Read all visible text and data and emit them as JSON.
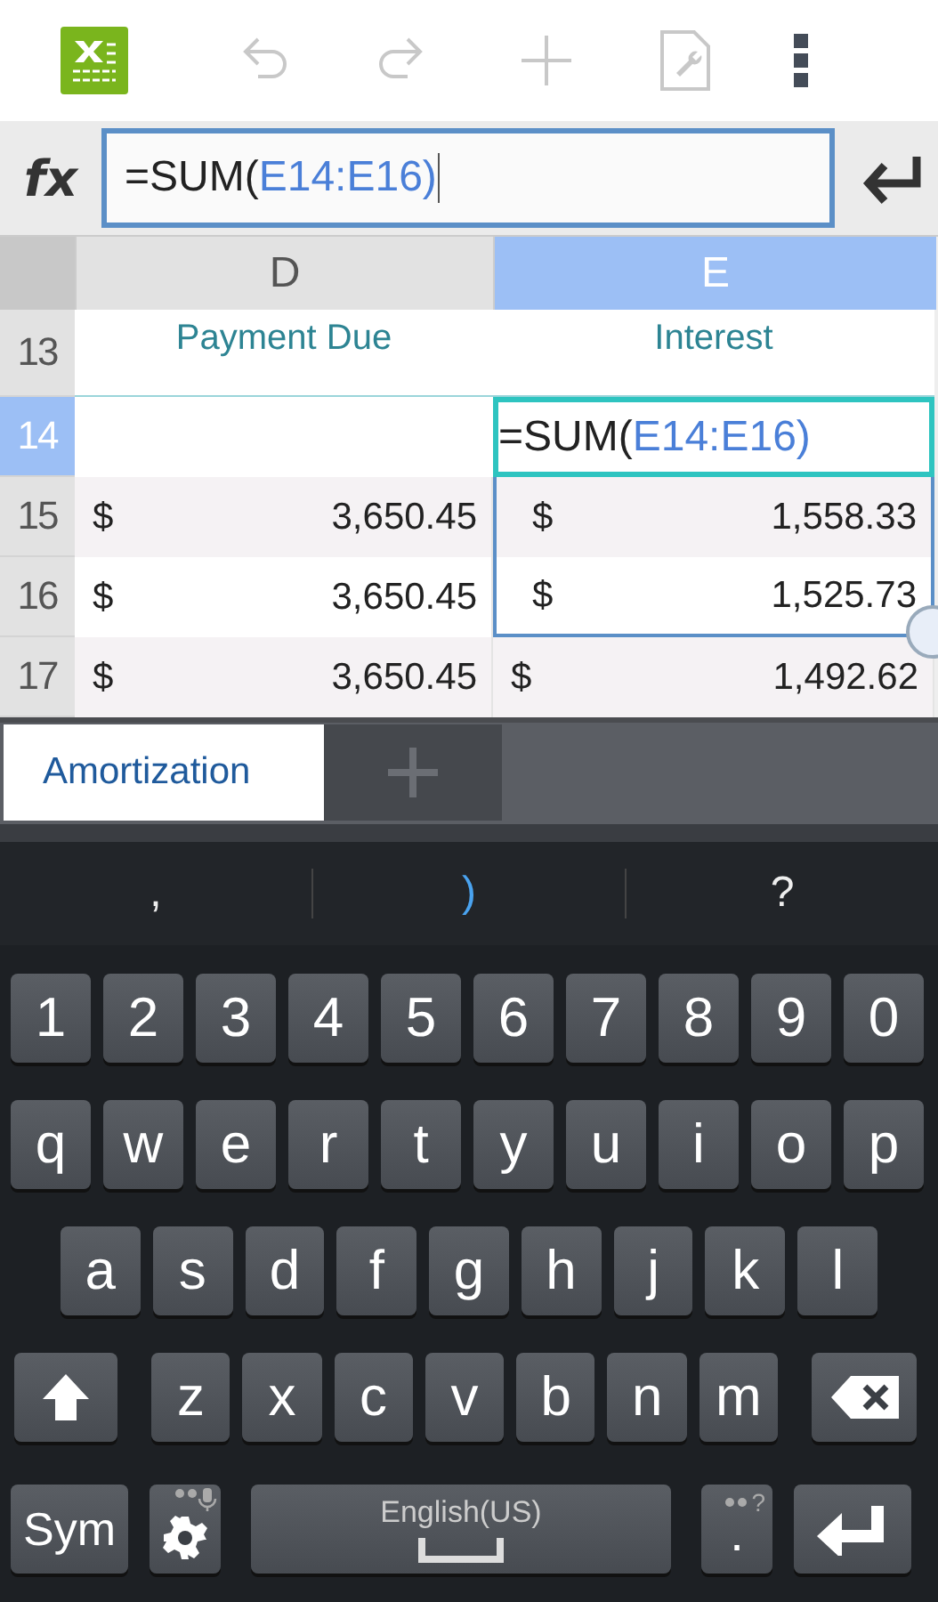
{
  "formula_bar": {
    "label": "fx",
    "parts": [
      {
        "text": "=SUM(",
        "kind": "plain"
      },
      {
        "text": "E14:E16)",
        "kind": "reference"
      }
    ]
  },
  "columns": [
    {
      "label": "D",
      "selected": false
    },
    {
      "label": "E",
      "selected": true
    }
  ],
  "rows": [
    {
      "number": "13",
      "selected": false,
      "kind": "heading",
      "cells": [
        {
          "kind": "heading",
          "text": "Payment Due"
        },
        {
          "kind": "heading",
          "text": "Interest"
        }
      ]
    },
    {
      "number": "14",
      "selected": true,
      "kind": "plain",
      "cells": [
        {
          "kind": "blank"
        },
        {
          "kind": "formula",
          "parts": [
            {
              "text": "=SUM(",
              "kind": "plain"
            },
            {
              "text": "E14:E16)",
              "kind": "reference"
            }
          ]
        }
      ]
    },
    {
      "number": "15",
      "selected": false,
      "kind": "shaded",
      "cells": [
        {
          "kind": "money",
          "currency": "$",
          "amount": "3,650.45",
          "in_range": false
        },
        {
          "kind": "money",
          "currency": "$",
          "amount": "1,558.33",
          "in_range": true
        }
      ]
    },
    {
      "number": "16",
      "selected": false,
      "kind": "plain",
      "cells": [
        {
          "kind": "money",
          "currency": "$",
          "amount": "3,650.45",
          "in_range": false
        },
        {
          "kind": "money",
          "currency": "$",
          "amount": "1,525.73",
          "in_range": true
        }
      ]
    },
    {
      "number": "17",
      "selected": false,
      "kind": "shaded",
      "cells": [
        {
          "kind": "money",
          "currency": "$",
          "amount": "3,650.45",
          "in_range": false
        },
        {
          "kind": "money",
          "currency": "$",
          "amount": "1,492.62",
          "in_range": false
        }
      ]
    }
  ],
  "sheet_tabs": [
    {
      "label": "Amortization",
      "selected": true
    }
  ],
  "suggestions": [
    {
      "text": ",",
      "selected": false
    },
    {
      "text": ")",
      "selected": true
    },
    {
      "text": "?",
      "selected": false
    }
  ],
  "keyboard": [
    [
      {
        "kind": "char",
        "label": "1"
      },
      {
        "kind": "char",
        "label": "2"
      },
      {
        "kind": "char",
        "label": "3"
      },
      {
        "kind": "char",
        "label": "4"
      },
      {
        "kind": "char",
        "label": "5"
      },
      {
        "kind": "char",
        "label": "6"
      },
      {
        "kind": "char",
        "label": "7"
      },
      {
        "kind": "char",
        "label": "8"
      },
      {
        "kind": "char",
        "label": "9"
      },
      {
        "kind": "char",
        "label": "0"
      }
    ],
    [
      {
        "kind": "char",
        "label": "q"
      },
      {
        "kind": "char",
        "label": "w"
      },
      {
        "kind": "char",
        "label": "e"
      },
      {
        "kind": "char",
        "label": "r"
      },
      {
        "kind": "char",
        "label": "t"
      },
      {
        "kind": "char",
        "label": "y"
      },
      {
        "kind": "char",
        "label": "u"
      },
      {
        "kind": "char",
        "label": "i"
      },
      {
        "kind": "char",
        "label": "o"
      },
      {
        "kind": "char",
        "label": "p"
      }
    ],
    [
      {
        "kind": "char",
        "label": "a"
      },
      {
        "kind": "char",
        "label": "s"
      },
      {
        "kind": "char",
        "label": "d"
      },
      {
        "kind": "char",
        "label": "f"
      },
      {
        "kind": "char",
        "label": "g"
      },
      {
        "kind": "char",
        "label": "h"
      },
      {
        "kind": "char",
        "label": "j"
      },
      {
        "kind": "char",
        "label": "k"
      },
      {
        "kind": "char",
        "label": "l"
      }
    ],
    [
      {
        "kind": "shift"
      },
      {
        "kind": "char",
        "label": "z"
      },
      {
        "kind": "char",
        "label": "x"
      },
      {
        "kind": "char",
        "label": "c"
      },
      {
        "kind": "char",
        "label": "v"
      },
      {
        "kind": "char",
        "label": "b"
      },
      {
        "kind": "char",
        "label": "n"
      },
      {
        "kind": "char",
        "label": "m"
      },
      {
        "kind": "backspace"
      }
    ],
    [
      {
        "kind": "sym",
        "label": "Sym"
      },
      {
        "kind": "settings"
      },
      {
        "kind": "space",
        "label": "English(US)"
      },
      {
        "kind": "period",
        "label": ".",
        "hint": "?"
      },
      {
        "kind": "enter"
      }
    ]
  ]
}
